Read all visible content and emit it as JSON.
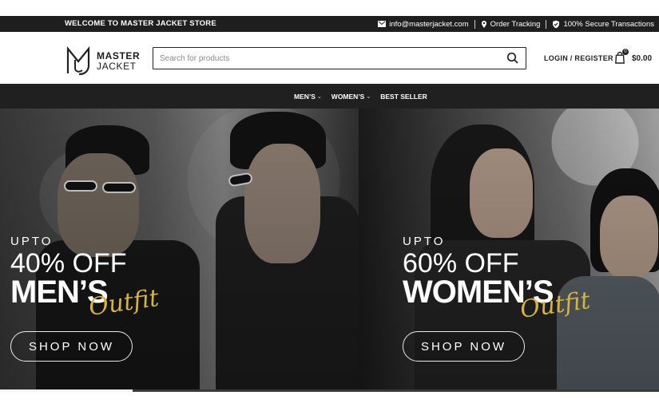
{
  "topbar": {
    "welcome": "WELCOME TO MASTER JACKET STORE",
    "email": "info@masterjacket.com",
    "order_tracking": "Order Tracking",
    "secure": "100% Secure Transactions",
    "icons": [
      "mail-icon",
      "location-icon",
      "shield-check-icon"
    ]
  },
  "header": {
    "logo": {
      "line1": "MASTER",
      "line2": "JACKET",
      "mark": "MJ"
    },
    "search": {
      "placeholder": "Search for products",
      "value": ""
    },
    "login_register": "LOGIN / REGISTER",
    "cart": {
      "count": "0",
      "total": "$0.00"
    }
  },
  "nav": {
    "items": [
      {
        "label": "MEN’S",
        "has_dropdown": true
      },
      {
        "label": "WOMEN’S",
        "has_dropdown": true
      },
      {
        "label": "BEST SELLER",
        "has_dropdown": false
      }
    ]
  },
  "banners": [
    {
      "upto": "UPTO",
      "discount": "40% OFF",
      "category": "MEN’S",
      "script": "Outfit",
      "button": "SHOP NOW"
    },
    {
      "upto": "UPTO",
      "discount": "60% OFF",
      "category": "WOMEN’S",
      "script": "Outfit",
      "button": "SHOP NOW"
    }
  ],
  "colors": {
    "topbar": "#1f1f1f",
    "navbar": "#202020",
    "text_dark": "#222222",
    "accent_gold": "#d6b43a"
  }
}
